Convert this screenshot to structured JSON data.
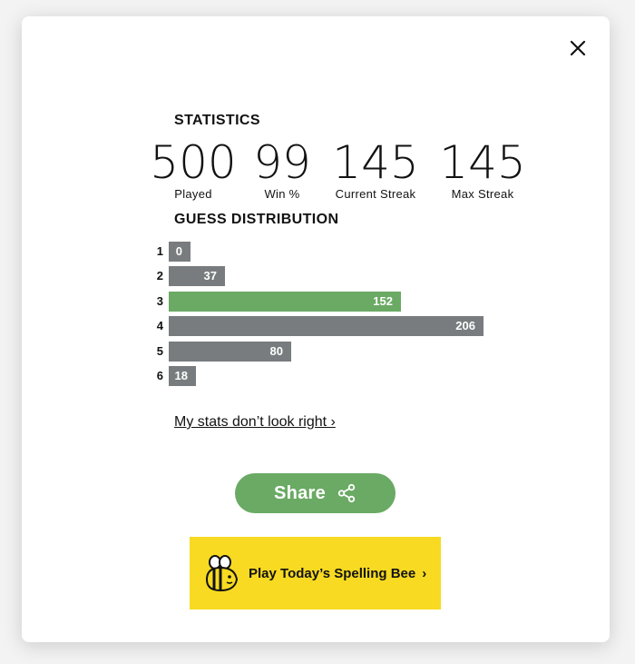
{
  "modal": {
    "close_icon": "close-icon",
    "statistics_heading": "STATISTICS",
    "stats": [
      {
        "value": "500",
        "label": "Played"
      },
      {
        "value": "99",
        "label": "Win %"
      },
      {
        "value": "145",
        "label": "Current Streak"
      },
      {
        "value": "145",
        "label": "Max Streak"
      }
    ],
    "distribution_heading": "GUESS DISTRIBUTION",
    "distribution": [
      {
        "guess": "1",
        "count": 0
      },
      {
        "guess": "2",
        "count": 37
      },
      {
        "guess": "3",
        "count": 152,
        "highlighted": true
      },
      {
        "guess": "4",
        "count": 206
      },
      {
        "guess": "5",
        "count": 80
      },
      {
        "guess": "6",
        "count": 18
      }
    ],
    "stats_link": "My stats don’t look right ›",
    "share_label": "Share",
    "share_icon": "share-icon",
    "bee_icon": "spelling-bee-icon",
    "bee_label": "Play Today’s Spelling Bee",
    "bee_chevron": "›"
  },
  "colors": {
    "bar_default": "#787c7e",
    "bar_highlight": "#6aaa64",
    "share_button": "#6aaa64",
    "bee_banner": "#f7da21"
  }
}
